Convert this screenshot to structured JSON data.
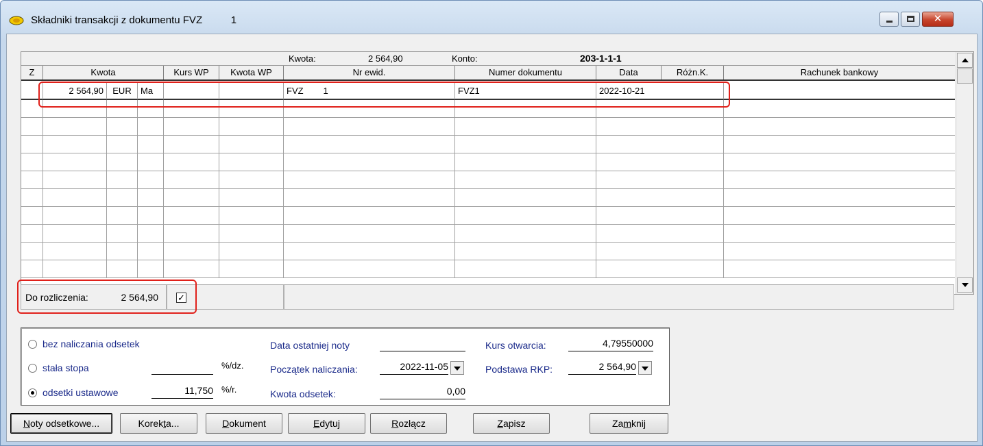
{
  "window": {
    "title": "Składniki transakcji z dokumentu FVZ",
    "title_number": "1",
    "close_glyph": "✕"
  },
  "infobar": {
    "kwota_label": "Kwota:",
    "kwota_value": "2 564,90",
    "konto_label": "Konto:",
    "konto_value": "203-1-1-1"
  },
  "table": {
    "columns": [
      "Z",
      "Kwota",
      "Kurs WP",
      "Kwota WP",
      "Nr ewid.",
      "Numer dokumentu",
      "Data",
      "Różn.K.",
      "Rachunek bankowy"
    ],
    "rows": [
      {
        "z": "",
        "kwota": "2 564,90",
        "waluta": "EUR",
        "strona": "Ma",
        "kurs_wp": "",
        "kwota_wp": "",
        "nr_ewid": "FVZ        1",
        "numer_dokumentu": "FVZ1",
        "data": "2022-10-21",
        "rozn_k": "",
        "rachunek": ""
      }
    ]
  },
  "summary": {
    "do_rozliczenia_label": "Do rozliczenia:",
    "do_rozliczenia_value": "2 564,90",
    "checkbox_checked": true,
    "check_glyph": "✓"
  },
  "interest": {
    "opt_none": "bez naliczania odsetek",
    "opt_fixed": "stała stopa",
    "opt_statutory": "odsetki ustawowe",
    "selected": "opt_statutory",
    "fixed_rate_value": "",
    "fixed_rate_unit": "%/dz.",
    "statutory_rate_value": "11,750",
    "statutory_rate_unit": "%/r.",
    "last_note_label": "Data ostatniej noty",
    "last_note_value": "",
    "start_label": "Początek naliczania:",
    "start_value": "2022-11-05",
    "amount_label": "Kwota odsetek:",
    "amount_value": "0,00",
    "opening_rate_label": "Kurs otwarcia:",
    "opening_rate_value": "4,79550000",
    "rkp_base_label": "Podstawa RKP:",
    "rkp_base_value": "2 564,90"
  },
  "buttons": {
    "noty_prefix": "N",
    "noty_rest": "oty odsetkowe...",
    "korekta_prefix": "Korek",
    "korekta_accel": "t",
    "korekta_rest": "a...",
    "dokument_accel": "D",
    "dokument_rest": "okument",
    "edytuj_accel": "E",
    "edytuj_rest": "dytuj",
    "rozlacz_accel": "R",
    "rozlacz_rest": "ozłącz",
    "zapisz_accel": "Z",
    "zapisz_rest": "apisz",
    "zamknij_prefix": "Za",
    "zamknij_accel": "m",
    "zamknij_rest": "knij"
  },
  "colors": {
    "highlight": "#e0201a",
    "label_blue": "#1a2a8a"
  }
}
